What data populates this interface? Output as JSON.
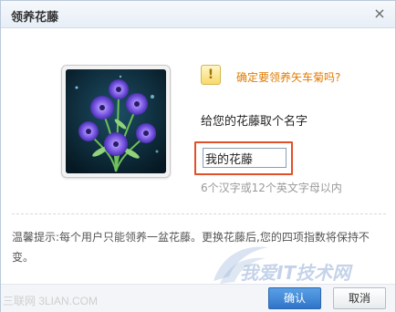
{
  "dialog": {
    "title": "领养花藤",
    "close_glyph": "×"
  },
  "confirm_text": "确定要领养矢车菊吗?",
  "prompt": "给您的花藤取个名字",
  "name_input": {
    "value": "我的花藤"
  },
  "hint": "6个汉字或12个英文字母以内",
  "tip": "温馨提示:每个用户只能领养一盆花藤。更换花藤后,您的四项指数将保持不变。",
  "buttons": {
    "ok": "确认",
    "cancel": "取消"
  },
  "watermarks": {
    "left": "三联网 3LIAN.COM",
    "right": "我爱IT技术网"
  },
  "icons": {
    "warning": "warning-icon",
    "close": "close-icon"
  },
  "colors": {
    "confirm_text": "#e07a00",
    "highlight_box": "#e2502a",
    "ok_button": "#3b82d0"
  }
}
